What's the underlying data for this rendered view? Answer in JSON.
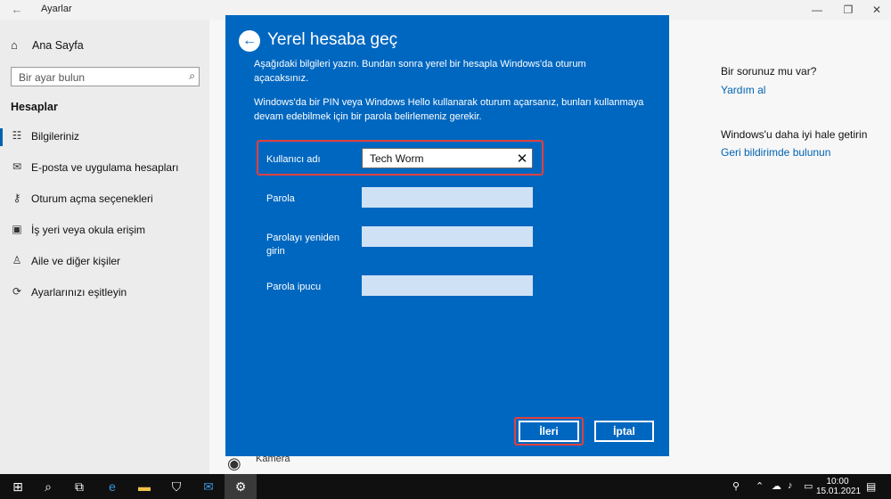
{
  "window": {
    "title": "Ayarlar"
  },
  "sidebar": {
    "home_label": "Ana Sayfa",
    "search_placeholder": "Bir ayar bulun",
    "section_title": "Hesaplar",
    "items": [
      {
        "label": "Bilgileriniz",
        "icon": "user-card-icon",
        "active": true
      },
      {
        "label": "E-posta ve uygulama hesapları",
        "icon": "mail-icon",
        "active": false
      },
      {
        "label": "Oturum açma seçenekleri",
        "icon": "key-icon",
        "active": false
      },
      {
        "label": "İş yeri veya okula erişim",
        "icon": "briefcase-icon",
        "active": false
      },
      {
        "label": "Aile ve diğer kişiler",
        "icon": "person-icon",
        "active": false
      },
      {
        "label": "Ayarlarınızı eşitleyin",
        "icon": "sync-icon",
        "active": false
      }
    ]
  },
  "main": {
    "camera_label": "Kamera"
  },
  "right_panel": {
    "question": "Bir sorunuz mu var?",
    "help_link": "Yardım al",
    "improve_title": "Windows'u daha iyi hale getirin",
    "feedback_link": "Geri bildirimde bulunun"
  },
  "dialog": {
    "title": "Yerel hesaba geç",
    "paragraph1": "Aşağıdaki bilgileri yazın. Bundan sonra yerel bir hesapla Windows'da oturum açacaksınız.",
    "paragraph2": "Windows'da bir PIN veya Windows Hello kullanarak oturum açarsanız, bunları kullanmaya devam edebilmek için bir parola belirlemeniz gerekir.",
    "fields": {
      "username": {
        "label": "Kullanıcı adı",
        "value": "Tech Worm"
      },
      "password": {
        "label": "Parola",
        "value": ""
      },
      "password_confirm": {
        "label": "Parolayı yeniden girin",
        "value": ""
      },
      "password_hint": {
        "label": "Parola ipucu",
        "value": ""
      }
    },
    "next_button": "İleri",
    "cancel_button": "İptal"
  },
  "taskbar": {
    "time": "10:00",
    "date": "15.01.2021"
  },
  "colors": {
    "dialog_bg": "#0067c0",
    "accent": "#0063b1",
    "highlight": "#e0413f"
  }
}
